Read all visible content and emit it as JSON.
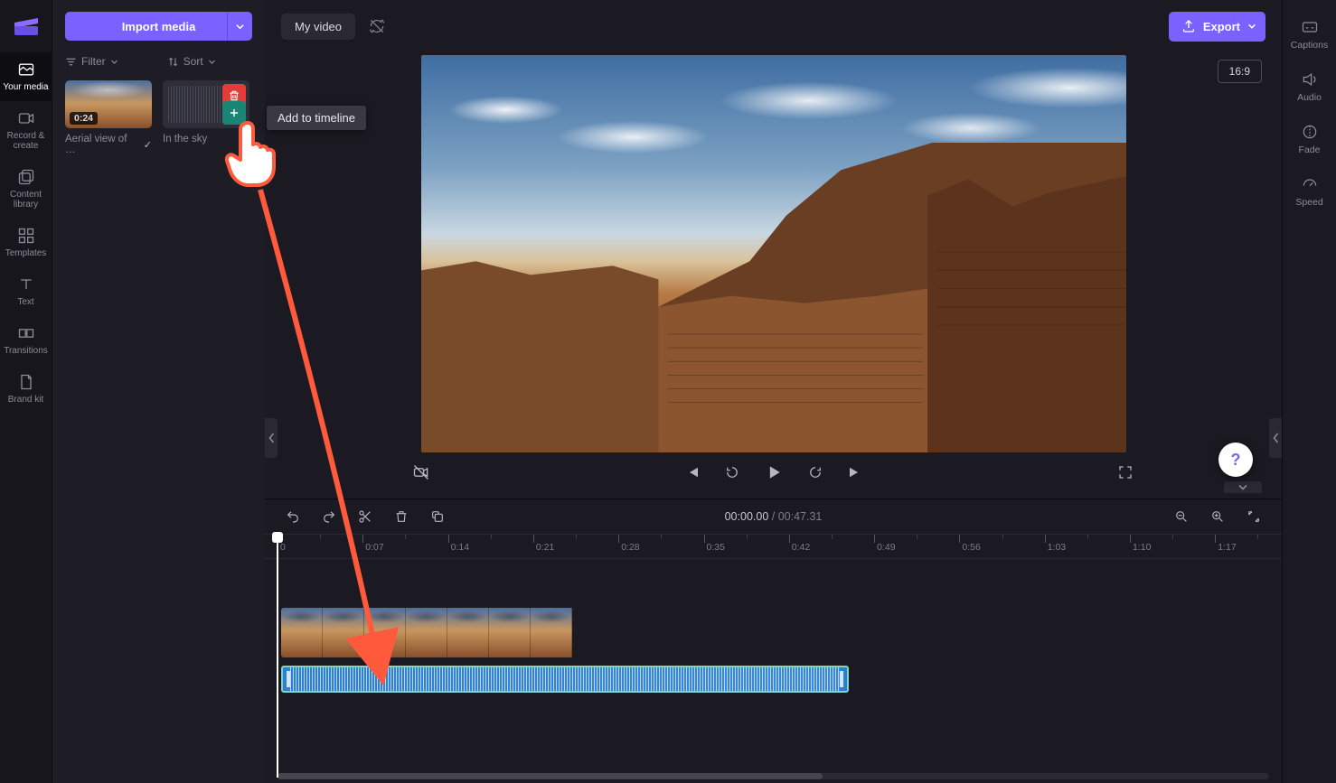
{
  "header": {
    "import_label": "Import media",
    "title": "My video",
    "export_label": "Export",
    "aspect": "16:9"
  },
  "left_rail": [
    {
      "icon": "your-media-icon",
      "label": "Your media"
    },
    {
      "icon": "record-icon",
      "label": "Record & create"
    },
    {
      "icon": "content-library-icon",
      "label": "Content library"
    },
    {
      "icon": "templates-icon",
      "label": "Templates"
    },
    {
      "icon": "text-icon",
      "label": "Text"
    },
    {
      "icon": "transitions-icon",
      "label": "Transitions"
    },
    {
      "icon": "brand-kit-icon",
      "label": "Brand kit"
    }
  ],
  "right_rail": [
    {
      "icon": "captions-icon",
      "label": "Captions"
    },
    {
      "icon": "audio-icon",
      "label": "Audio"
    },
    {
      "icon": "fade-icon",
      "label": "Fade"
    },
    {
      "icon": "speed-icon",
      "label": "Speed"
    }
  ],
  "media_panel": {
    "filter_label": "Filter",
    "sort_label": "Sort",
    "items": [
      {
        "type": "video",
        "name": "Aerial view of …",
        "duration": "0:24",
        "in_timeline": true
      },
      {
        "type": "audio",
        "name": "In the sky"
      }
    ]
  },
  "tooltip": "Add to timeline",
  "playback": {
    "current": "00:00.00",
    "total": "00:47.31"
  },
  "ruler": [
    "0",
    "0:07",
    "0:14",
    "0:21",
    "0:28",
    "0:35",
    "0:42",
    "0:49",
    "0:56",
    "1:03",
    "1:10",
    "1:17"
  ],
  "annotation": {
    "description": "Tutorial pointer showing a hand clicking the Add-to-timeline button on an audio clip, with a red arrow leading down to the audio track in the timeline."
  }
}
